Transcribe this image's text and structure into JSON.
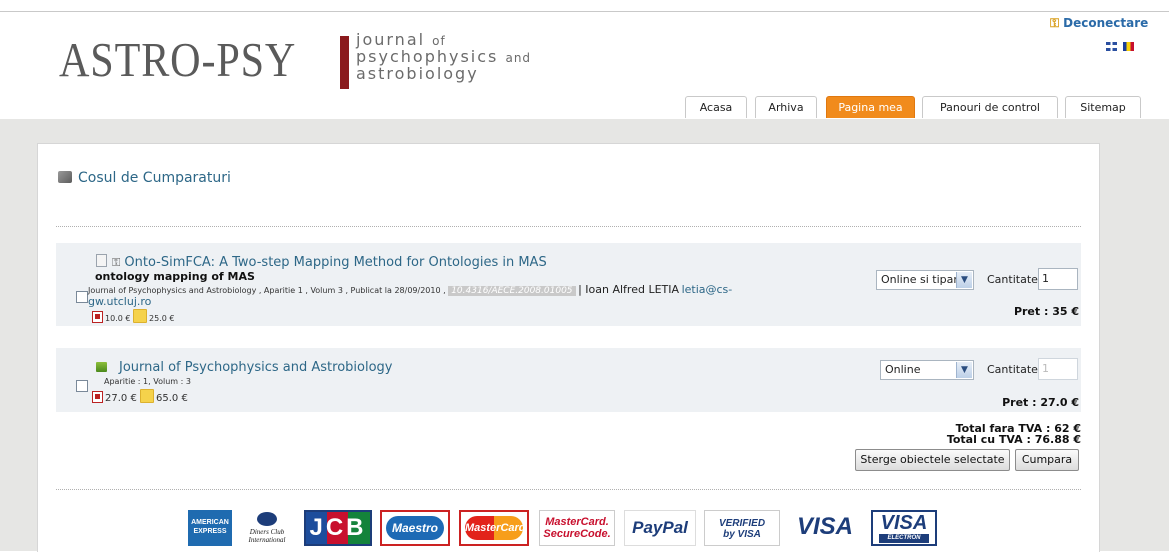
{
  "header": {
    "logo_main": "ASTRO-PSY",
    "logo_line1": "journal",
    "logo_line1_small": "of",
    "logo_line2": "psychophysics",
    "logo_line2_small": "and",
    "logo_line3": "astrobiology",
    "logout_label": "Deconectare",
    "languages": [
      "EN",
      "RO"
    ]
  },
  "nav": {
    "tabs": [
      {
        "label": "Acasa"
      },
      {
        "label": "Arhiva"
      },
      {
        "label": "Pagina mea",
        "active": true
      },
      {
        "label": "Panouri de control"
      },
      {
        "label": "Sitemap"
      }
    ]
  },
  "cart": {
    "title": "Cosul de Cumparaturi",
    "items": [
      {
        "title": "Onto-SimFCA: A Two-step Mapping Method for Ontologies in MAS",
        "subtitle": "ontology mapping of MAS",
        "meta": "Journal of Psychophysics and Astrobiology , Aparitie 1 , Volum 3 , Publicat la 28/09/2010 ,",
        "doi": "10.4316/AECE.2008.01005",
        "author": "| Ioan Alfred LETIA",
        "email_part1": "letia@cs-",
        "email_part2": "gw.utcluj.ro",
        "price_online": "10.0 €",
        "price_print": "25.0 €",
        "format": "Online si tiparit",
        "qty_label": "Cantitate",
        "qty": "1",
        "total": "Pret : 35 €"
      },
      {
        "title": "Journal of Psychophysics and Astrobiology",
        "issue": "Aparitie : 1,",
        "volume": "Volum : 3",
        "price_online": "27.0 €",
        "price_print": "65.0 €",
        "format": "Online",
        "qty_label": "Cantitate",
        "qty": "1",
        "total": "Pret : 27.0 €"
      }
    ],
    "total_no_vat": "Total fara TVA : 62 €",
    "total_with_vat": "Total cu TVA : 76.88 €",
    "delete_button": "Sterge obiectele selectate",
    "buy_button": "Cumpara"
  },
  "payment_logos": {
    "amex_1": "AMERICAN",
    "amex_2": "EXPRESS",
    "diners_1": "Diners Club",
    "diners_2": "International",
    "jcb": "JCB",
    "maestro": "Maestro",
    "mastercard": "MasterCard",
    "securecode_1": "MasterCard.",
    "securecode_2": "SecureCode.",
    "paypal": "PayPal",
    "verified_1": "VERIFIED",
    "verified_2": "by VISA",
    "visa": "VISA",
    "visa_electron": "VISA",
    "visa_electron_sub": "ELECTRON"
  }
}
